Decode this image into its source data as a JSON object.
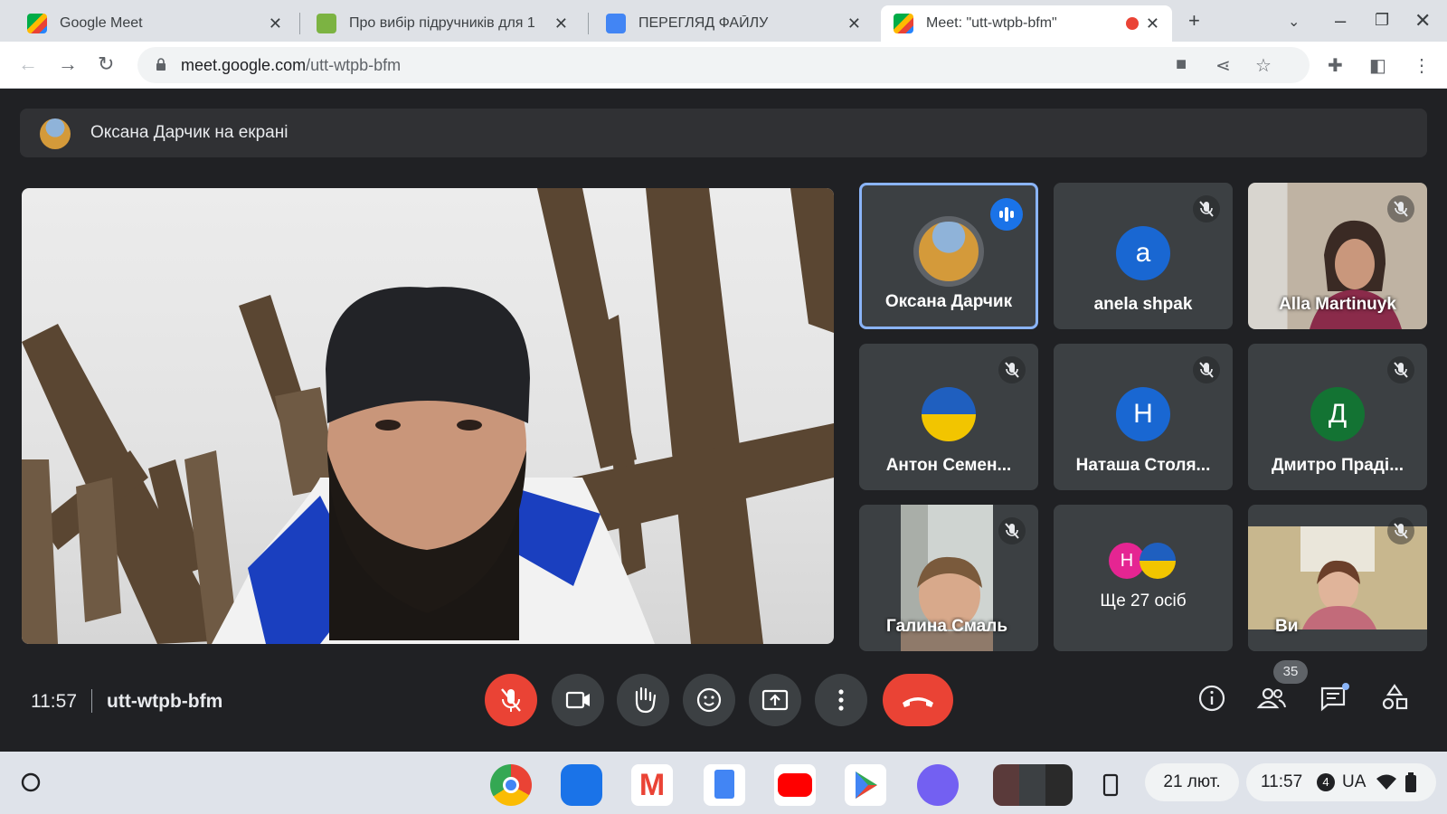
{
  "browser": {
    "tabs": [
      {
        "title": "Google Meet",
        "favicon": "meet-icon"
      },
      {
        "title": "Про вибір підручників для 1",
        "favicon": "mail-icon"
      },
      {
        "title": "ПЕРЕГЛЯД ФАЙЛУ",
        "favicon": "file-viewer-icon"
      },
      {
        "title": "Meet: \"utt-wtpb-bfm\"",
        "favicon": "meet-icon",
        "active": true,
        "recording": true
      }
    ],
    "url_host": "meet.google.com",
    "url_path": "/utt-wtpb-bfm"
  },
  "meet": {
    "presenting_banner": "Оксана Дарчик на екрані",
    "participants": [
      {
        "name": "Оксана Дарчик",
        "avatar": "photo-wheat",
        "state": "speaking"
      },
      {
        "name": "anela shpak",
        "initial": "a",
        "color": "#1967d2",
        "state": "muted"
      },
      {
        "name": "Alla Martinuyk",
        "avatar": "video",
        "state": "muted"
      },
      {
        "name": "Антон Семен...",
        "avatar": "photo-ua-flag",
        "state": "muted"
      },
      {
        "name": "Наташа Столя...",
        "initial": "Н",
        "color": "#1967d2",
        "state": "muted"
      },
      {
        "name": "Дмитро Праді...",
        "initial": "Д",
        "color": "#137333",
        "state": "muted"
      },
      {
        "name": "Галина Смаль",
        "avatar": "video",
        "state": "muted"
      },
      {
        "name": "Ще 27 осіб",
        "initial": "Н",
        "color": "#e52592",
        "state": "overflow"
      },
      {
        "name": "Ви",
        "avatar": "video",
        "state": "muted"
      }
    ],
    "time": "11:57",
    "meeting_code": "utt-wtpb-bfm",
    "participant_count": "35"
  },
  "shelf": {
    "apps": [
      "chrome-icon",
      "files-icon",
      "gmail-icon",
      "docs-icon",
      "youtube-icon",
      "play-store-icon",
      "viber-icon",
      "windows-preview",
      "phone-hub-icon"
    ],
    "date": "21 лют.",
    "time": "11:57",
    "notifications": "4",
    "keyboard_layout": "UA"
  }
}
